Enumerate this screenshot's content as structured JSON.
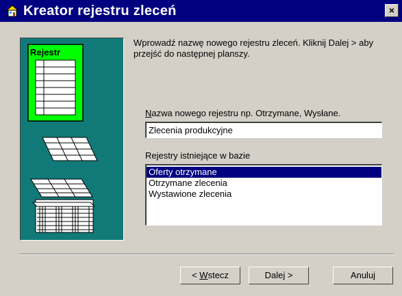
{
  "window": {
    "title": "Kreator rejestru zleceń",
    "close_label": "×"
  },
  "side_panel": {
    "register_label": "Rejestr",
    "colors": {
      "background": "#117a78",
      "card": "#00ff00"
    }
  },
  "instruction": "Wprowadź nazwę nowego rejestru zleceń. Kliknij Dalej > aby przejść do następnej planszy.",
  "name_field": {
    "label_accel": "N",
    "label_rest": "azwa nowego rejestru np. Otrzymane, Wysłane.",
    "value": "Zlecenia produkcyjne"
  },
  "existing_registers": {
    "label": "Rejestry istniejące w bazie",
    "items": [
      "Oferty otrzymane",
      "Otrzymane zlecenia",
      "Wystawione zlecenia"
    ],
    "selected_index": 0
  },
  "buttons": {
    "back_prefix": "< ",
    "back_accel": "W",
    "back_rest": "stecz",
    "next": "Dalej >",
    "cancel": "Anuluj"
  }
}
